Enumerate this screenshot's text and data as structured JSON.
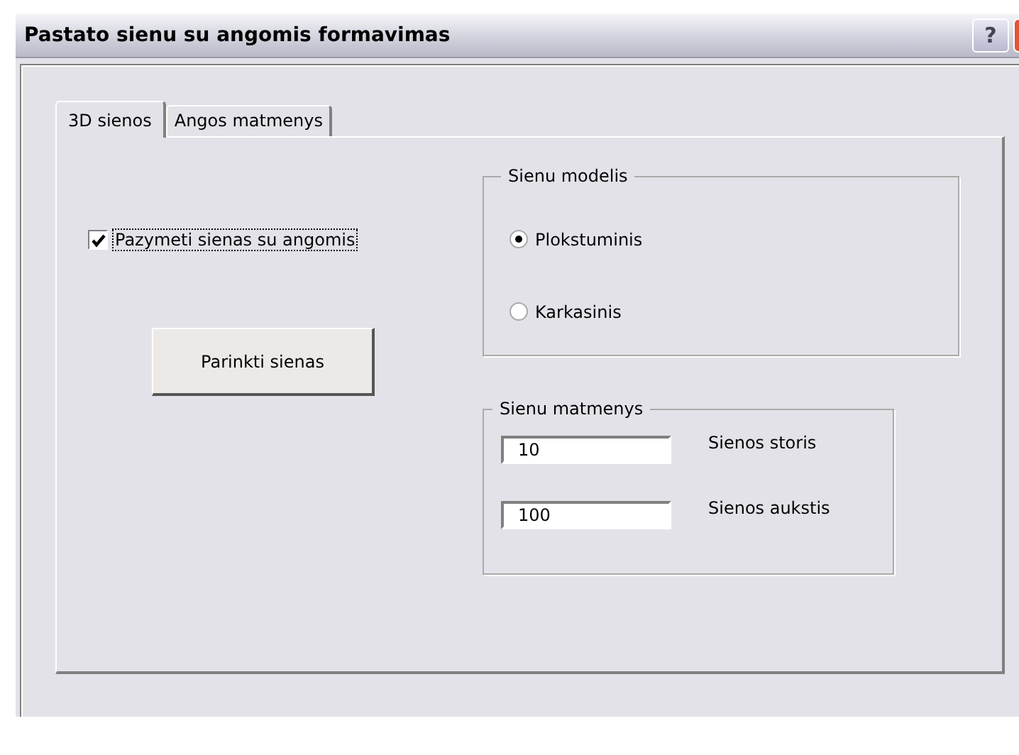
{
  "window": {
    "title": "Pastato sienu su angomis formavimas",
    "help": "?"
  },
  "tabs": [
    {
      "label": "3D sienos",
      "selected": true
    },
    {
      "label": "Angos matmenys",
      "selected": false
    }
  ],
  "checkbox": {
    "label": "Pazymeti sienas su angomis",
    "checked": true
  },
  "button": "Parinkti sienas",
  "model_group": {
    "title": "Sienu modelis",
    "options": [
      {
        "label": "Plokstuminis",
        "selected": true
      },
      {
        "label": "Karkasinis",
        "selected": false
      }
    ]
  },
  "size_group": {
    "title": "Sienu matmenys",
    "fields": [
      {
        "value": "10",
        "label": "Sienos storis"
      },
      {
        "value": "100",
        "label": "Sienos aukstis"
      }
    ]
  }
}
